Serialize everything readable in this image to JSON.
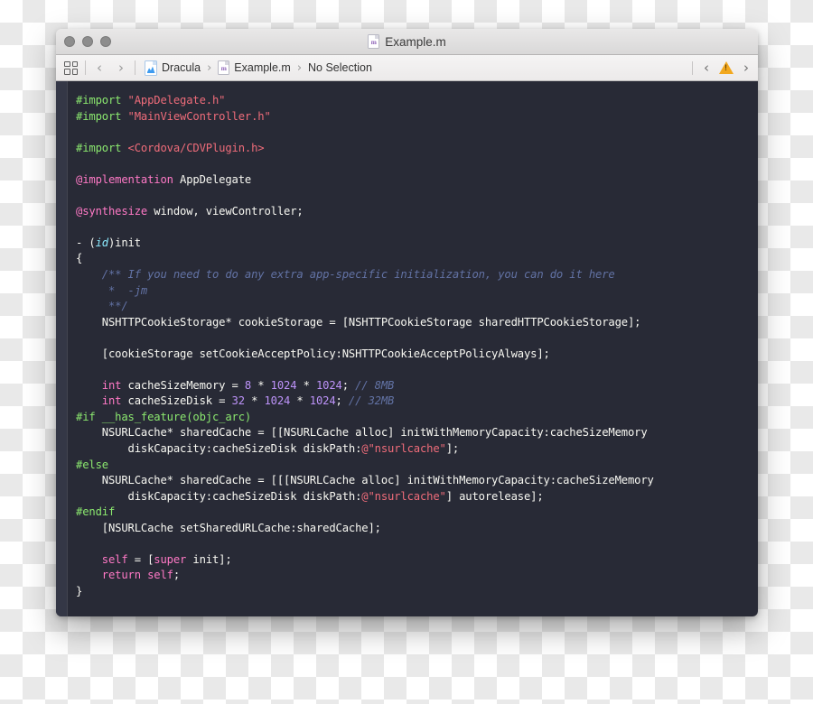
{
  "window": {
    "title": "Example.m",
    "title_icon": "objc-document-icon",
    "traffic_lights": [
      "close-button",
      "minimize-button",
      "zoom-button"
    ]
  },
  "toolbar": {
    "panel_toggle_icon": "grid-panel-icon",
    "back_icon": "chevron-left-icon",
    "forward_icon": "chevron-right-icon",
    "breadcrumb": [
      {
        "icon": "project-document-icon",
        "label": "Dracula"
      },
      {
        "icon": "objc-document-icon",
        "label": "Example.m"
      },
      {
        "icon": null,
        "label": "No Selection"
      }
    ],
    "separator": "›",
    "right": {
      "prev_issue_icon": "chevron-left-icon",
      "warning_icon": "warning-triangle-icon",
      "next_issue_icon": "chevron-right-icon"
    }
  },
  "editor": {
    "theme": "Dracula",
    "background": "#282a36",
    "gutter_background": "#343746",
    "colors": {
      "foreground": "#f8f8f2",
      "preprocessor": "#8be86f",
      "string": "#ef6c7a",
      "keyword": "#ff79c6",
      "type": "#8be9fd",
      "comment": "#6272a4",
      "number": "#bd93f9"
    },
    "lines": [
      [
        {
          "t": "#import ",
          "c": "t-pre"
        },
        {
          "t": "\"AppDelegate.h\"",
          "c": "t-str"
        }
      ],
      [
        {
          "t": "#import ",
          "c": "t-pre"
        },
        {
          "t": "\"MainViewController.h\"",
          "c": "t-str"
        }
      ],
      [],
      [
        {
          "t": "#import ",
          "c": "t-pre"
        },
        {
          "t": "<Cordova/CDVPlugin.h>",
          "c": "t-str"
        }
      ],
      [],
      [
        {
          "t": "@implementation",
          "c": "t-kw"
        },
        {
          "t": " AppDelegate",
          "c": "t-pln"
        }
      ],
      [],
      [
        {
          "t": "@synthesize",
          "c": "t-kw"
        },
        {
          "t": " window, viewController;",
          "c": "t-pln"
        }
      ],
      [],
      [
        {
          "t": "- (",
          "c": "t-pln"
        },
        {
          "t": "id",
          "c": "t-type"
        },
        {
          "t": ")init",
          "c": "t-pln"
        }
      ],
      [
        {
          "t": "{",
          "c": "t-pln"
        }
      ],
      [
        {
          "t": "    /** If you need to do any extra app-specific initialization, you can do it here",
          "c": "t-com"
        }
      ],
      [
        {
          "t": "     *  -jm",
          "c": "t-com"
        }
      ],
      [
        {
          "t": "     **/",
          "c": "t-com"
        }
      ],
      [
        {
          "t": "    NSHTTPCookieStorage* cookieStorage = [NSHTTPCookieStorage sharedHTTPCookieStorage];",
          "c": "t-pln"
        }
      ],
      [],
      [
        {
          "t": "    [cookieStorage setCookieAcceptPolicy:NSHTTPCookieAcceptPolicyAlways];",
          "c": "t-pln"
        }
      ],
      [],
      [
        {
          "t": "    ",
          "c": "t-pln"
        },
        {
          "t": "int",
          "c": "t-kw"
        },
        {
          "t": " cacheSizeMemory = ",
          "c": "t-pln"
        },
        {
          "t": "8",
          "c": "t-num"
        },
        {
          "t": " * ",
          "c": "t-pln"
        },
        {
          "t": "1024",
          "c": "t-num"
        },
        {
          "t": " * ",
          "c": "t-pln"
        },
        {
          "t": "1024",
          "c": "t-num"
        },
        {
          "t": "; ",
          "c": "t-pln"
        },
        {
          "t": "// 8MB",
          "c": "t-com"
        }
      ],
      [
        {
          "t": "    ",
          "c": "t-pln"
        },
        {
          "t": "int",
          "c": "t-kw"
        },
        {
          "t": " cacheSizeDisk = ",
          "c": "t-pln"
        },
        {
          "t": "32",
          "c": "t-num"
        },
        {
          "t": " * ",
          "c": "t-pln"
        },
        {
          "t": "1024",
          "c": "t-num"
        },
        {
          "t": " * ",
          "c": "t-pln"
        },
        {
          "t": "1024",
          "c": "t-num"
        },
        {
          "t": "; ",
          "c": "t-pln"
        },
        {
          "t": "// 32MB",
          "c": "t-com"
        }
      ],
      [
        {
          "t": "#if __has_feature(objc_arc)",
          "c": "t-pre"
        }
      ],
      [
        {
          "t": "    NSURLCache* sharedCache = [[NSURLCache alloc] initWithMemoryCapacity:cacheSizeMemory",
          "c": "t-pln"
        }
      ],
      [
        {
          "t": "        diskCapacity:cacheSizeDisk diskPath:",
          "c": "t-pln"
        },
        {
          "t": "@\"nsurlcache\"",
          "c": "t-str"
        },
        {
          "t": "];",
          "c": "t-pln"
        }
      ],
      [
        {
          "t": "#else",
          "c": "t-pre"
        }
      ],
      [
        {
          "t": "    NSURLCache* sharedCache = [[[NSURLCache alloc] initWithMemoryCapacity:cacheSizeMemory",
          "c": "t-pln"
        }
      ],
      [
        {
          "t": "        diskCapacity:cacheSizeDisk diskPath:",
          "c": "t-pln"
        },
        {
          "t": "@\"nsurlcache\"",
          "c": "t-str"
        },
        {
          "t": "] autorelease];",
          "c": "t-pln"
        }
      ],
      [
        {
          "t": "#endif",
          "c": "t-pre"
        }
      ],
      [
        {
          "t": "    [NSURLCache setSharedURLCache:sharedCache];",
          "c": "t-pln"
        }
      ],
      [],
      [
        {
          "t": "    ",
          "c": "t-pln"
        },
        {
          "t": "self",
          "c": "t-kw"
        },
        {
          "t": " = [",
          "c": "t-pln"
        },
        {
          "t": "super",
          "c": "t-kw"
        },
        {
          "t": " init];",
          "c": "t-pln"
        }
      ],
      [
        {
          "t": "    ",
          "c": "t-pln"
        },
        {
          "t": "return",
          "c": "t-kw"
        },
        {
          "t": " ",
          "c": "t-pln"
        },
        {
          "t": "self",
          "c": "t-kw"
        },
        {
          "t": ";",
          "c": "t-pln"
        }
      ],
      [
        {
          "t": "}",
          "c": "t-pln"
        }
      ]
    ]
  }
}
